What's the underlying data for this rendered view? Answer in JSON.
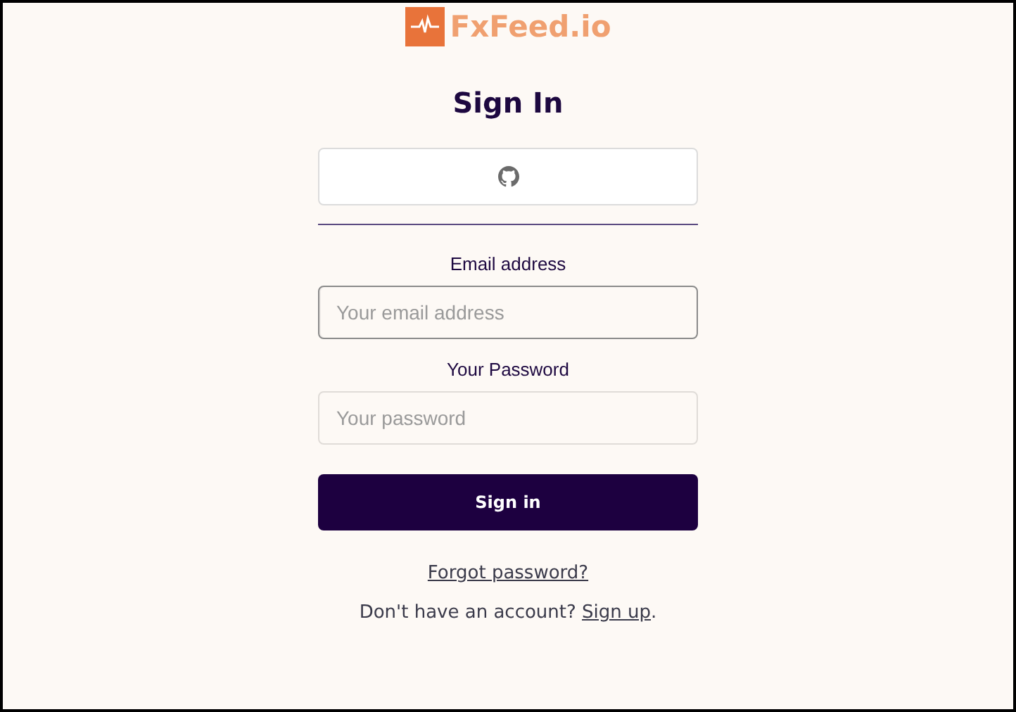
{
  "brand": {
    "name": "FxFeed.io"
  },
  "title": "Sign In",
  "fields": [
    {
      "label": "Email address",
      "placeholder": "Your email address",
      "focused": true
    },
    {
      "label": "Your Password",
      "placeholder": "Your password",
      "focused": false
    }
  ],
  "submit": "Sign in",
  "forgot_link": "Forgot password?",
  "signup": {
    "prompt": "Don't have an account? ",
    "link": "Sign up",
    "end": "."
  }
}
